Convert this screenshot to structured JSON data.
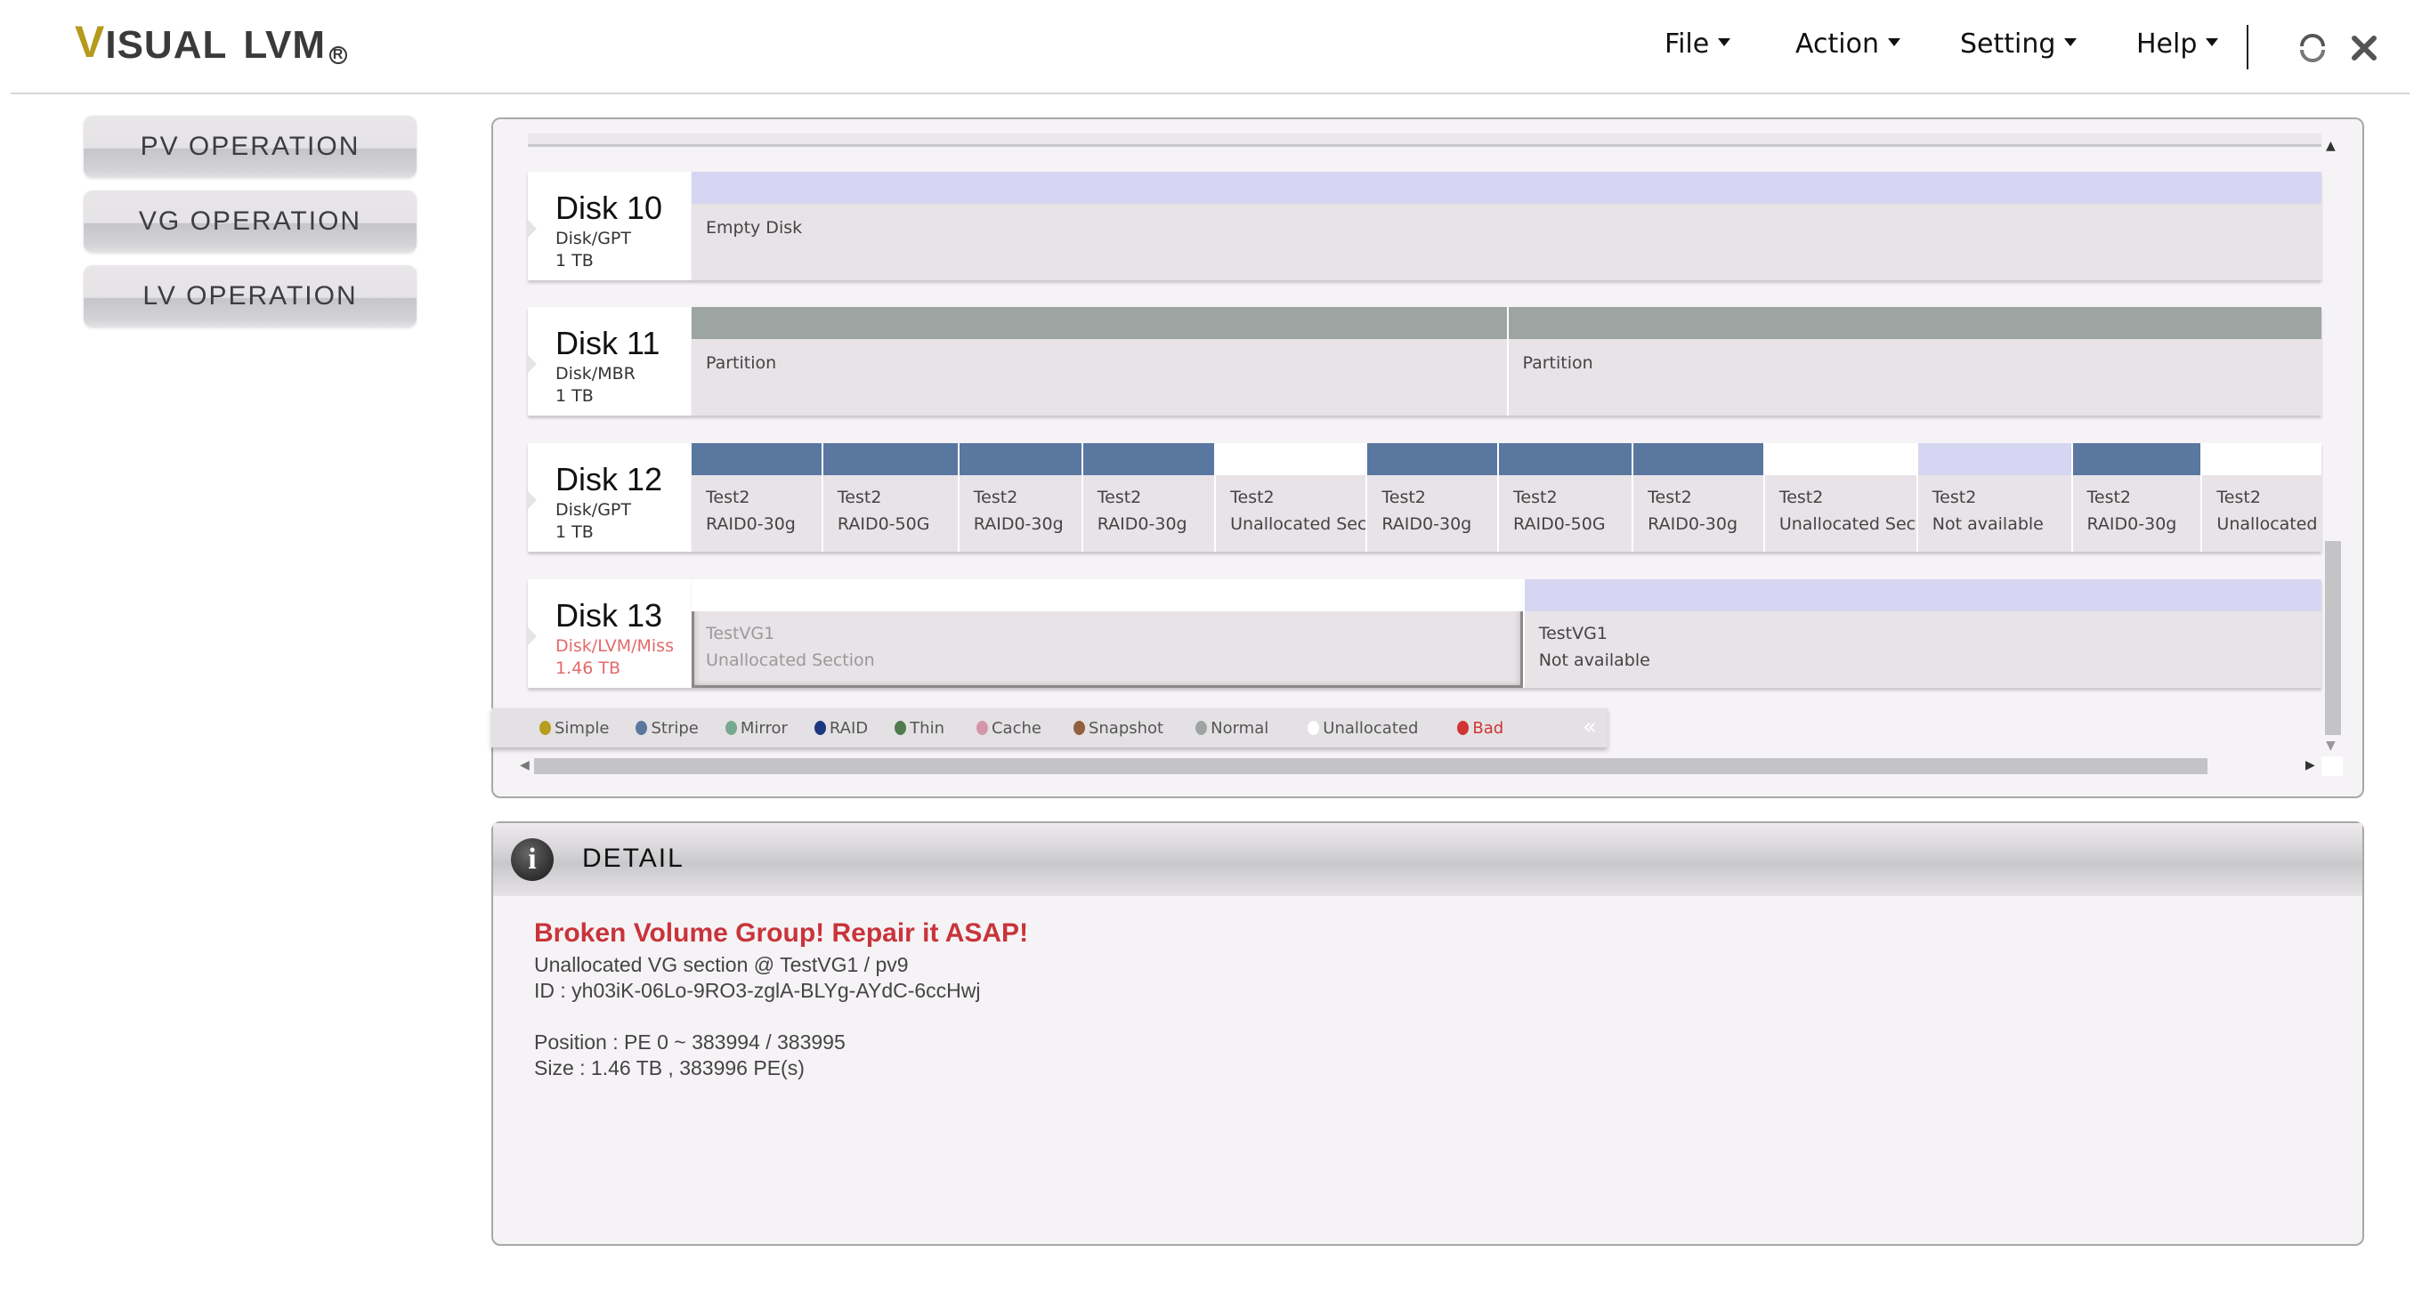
{
  "app": {
    "logo_v": "V",
    "logo_rest": "ISUAL",
    "logo_lvm": "LVM",
    "logo_reg": "R"
  },
  "menu": [
    {
      "label": "File"
    },
    {
      "label": "Action"
    },
    {
      "label": "Setting"
    },
    {
      "label": "Help"
    }
  ],
  "header_icons": {
    "refresh": "refresh-icon",
    "close": "close-icon"
  },
  "sidebar": {
    "items": [
      {
        "label": "PV OPERATION"
      },
      {
        "label": "VG OPERATION"
      },
      {
        "label": "LV OPERATION"
      }
    ]
  },
  "colors": {
    "simple": "#b89c1e",
    "stripe": "#5a77a0",
    "mirror": "#76a892",
    "raid": "#1c3880",
    "thin": "#4e7b4e",
    "cache": "#d596aa",
    "snapshot": "#91603f",
    "normal": "#9da5a3",
    "unallocated": "#ffffff",
    "bad": "#d03434",
    "not_available": "#d6d6f2",
    "headline": "#c8343a"
  },
  "disks": [
    {
      "name": "Disk 10",
      "type": "Disk/GPT",
      "size": "1 TB",
      "bad": false,
      "segments": [
        {
          "kind": "not_available",
          "weight": 1,
          "line1": "Empty Disk",
          "line2": ""
        }
      ]
    },
    {
      "name": "Disk 11",
      "type": "Disk/MBR",
      "size": "1 TB",
      "bad": false,
      "segments": [
        {
          "kind": "normal",
          "weight": 1,
          "line1": "Partition",
          "line2": ""
        },
        {
          "kind": "normal",
          "weight": 1,
          "line1": "Partition",
          "line2": ""
        }
      ]
    },
    {
      "name": "Disk 12",
      "type": "Disk/GPT",
      "size": "1 TB",
      "bad": false,
      "segments": [
        {
          "kind": "stripe",
          "weight": 84,
          "line1": "Test2",
          "line2": "RAID0-30g"
        },
        {
          "kind": "stripe",
          "weight": 88,
          "line1": "Test2",
          "line2": "RAID0-50G"
        },
        {
          "kind": "stripe",
          "weight": 80,
          "line1": "Test2",
          "line2": "RAID0-30g"
        },
        {
          "kind": "stripe",
          "weight": 86,
          "line1": "Test2",
          "line2": "RAID0-30g"
        },
        {
          "kind": "unallocated",
          "weight": 98,
          "line1": "Test2",
          "line2": "Unallocated Section"
        },
        {
          "kind": "stripe",
          "weight": 85,
          "line1": "Test2",
          "line2": "RAID0-30g"
        },
        {
          "kind": "stripe",
          "weight": 87,
          "line1": "Test2",
          "line2": "RAID0-50G"
        },
        {
          "kind": "stripe",
          "weight": 85,
          "line1": "Test2",
          "line2": "RAID0-30g"
        },
        {
          "kind": "unallocated",
          "weight": 99,
          "line1": "Test2",
          "line2": "Unallocated Section"
        },
        {
          "kind": "not_available",
          "weight": 100,
          "line1": "Test2",
          "line2": "Not available"
        },
        {
          "kind": "stripe",
          "weight": 84,
          "line1": "Test2",
          "line2": "RAID0-30g"
        },
        {
          "kind": "unallocated",
          "weight": 78,
          "line1": "Test2",
          "line2": "Unallocated Section"
        }
      ]
    },
    {
      "name": "Disk 13",
      "type": "Disk/LVM/Miss",
      "size": "1.46 TB",
      "bad": true,
      "segments": [
        {
          "kind": "unallocated",
          "weight": 538,
          "line1": "TestVG1",
          "line2": "Unallocated Section",
          "selected": true
        },
        {
          "kind": "not_available",
          "weight": 517,
          "line1": "TestVG1",
          "line2": "Not available"
        }
      ]
    }
  ],
  "legend": [
    {
      "label": "Simple",
      "key": "simple"
    },
    {
      "label": "Stripe",
      "key": "stripe"
    },
    {
      "label": "Mirror",
      "key": "mirror"
    },
    {
      "label": "RAID",
      "key": "raid"
    },
    {
      "label": "Thin",
      "key": "thin"
    },
    {
      "label": "Cache",
      "key": "cache"
    },
    {
      "label": "Snapshot",
      "key": "snapshot"
    },
    {
      "label": "Normal",
      "key": "normal"
    },
    {
      "label": "Unallocated",
      "key": "unallocated"
    },
    {
      "label": "Bad",
      "key": "bad"
    }
  ],
  "legend_collapse": "«",
  "detail": {
    "title": "DETAIL",
    "headline": "Broken Volume Group! Repair it ASAP!",
    "lines": [
      "Unallocated VG section @ TestVG1 / pv9",
      "ID : yh03iK-06Lo-9RO3-zglA-BLYg-AYdC-6ccHwj",
      "",
      "Position : PE 0 ~ 383994 / 383995",
      "Size : 1.46 TB , 383996 PE(s)"
    ]
  }
}
